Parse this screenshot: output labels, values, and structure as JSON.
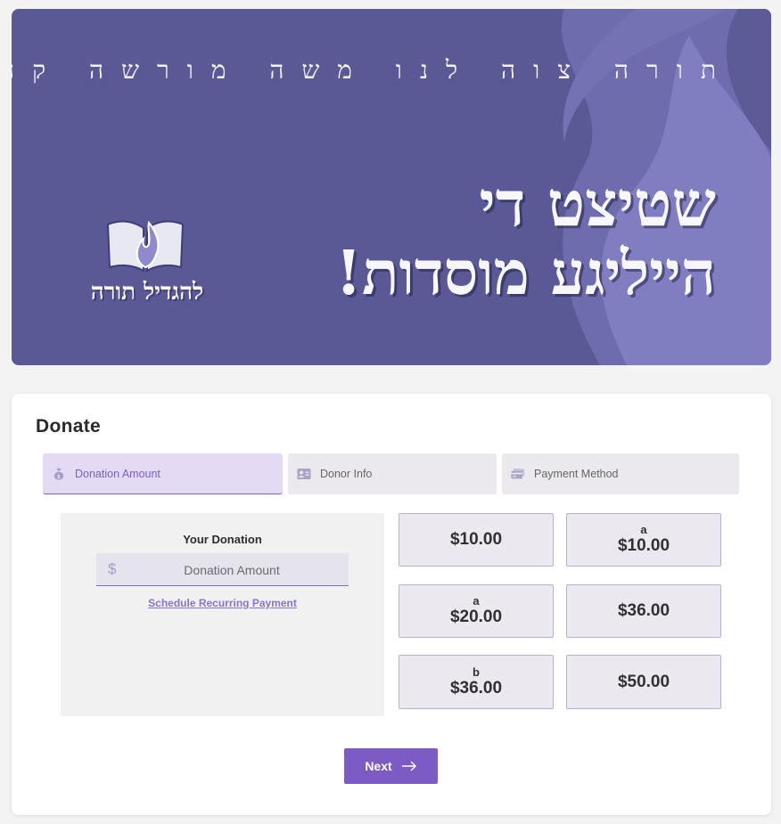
{
  "banner": {
    "motto": "תורה צוה לנו משה מורשה קהלת יעקב",
    "headline_line1": "שטיצט די",
    "headline_line2": "הייליגע מוסדות!",
    "logo_text": "להגדיל תורה",
    "colors": {
      "background": "#5a5996",
      "flame": "#7e7bbd"
    }
  },
  "donate": {
    "title": "Donate",
    "tabs": [
      {
        "label": "Donation Amount",
        "icon": "money-bag-icon",
        "active": true
      },
      {
        "label": "Donor Info",
        "icon": "contact-card-icon",
        "active": false
      },
      {
        "label": "Payment Method",
        "icon": "credit-card-icon",
        "active": false
      }
    ],
    "your_donation_label": "Your Donation",
    "currency_symbol": "$",
    "amount_placeholder": "Donation Amount",
    "schedule_link": "Schedule Recurring Payment",
    "amount_options": [
      {
        "label": "",
        "amount": "$10.00"
      },
      {
        "label": "a",
        "amount": "$10.00"
      },
      {
        "label": "a",
        "amount": "$20.00"
      },
      {
        "label": "",
        "amount": "$36.00"
      },
      {
        "label": "b",
        "amount": "$36.00"
      },
      {
        "label": "",
        "amount": "$50.00"
      }
    ],
    "next_label": "Next",
    "accent_color": "#7c5cc4"
  }
}
